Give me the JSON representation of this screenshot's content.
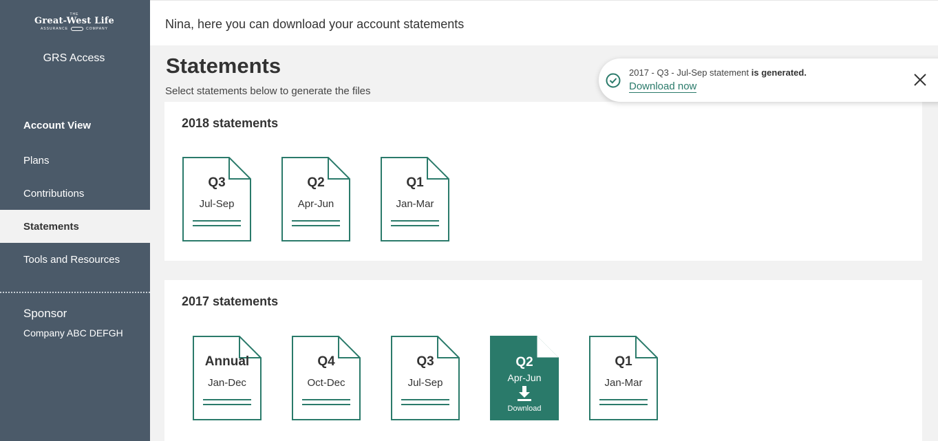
{
  "sidebar": {
    "logo": {
      "top": "THE",
      "name": "Great-West Life",
      "left_sub": "ASSURANCE",
      "right_sub": "COMPANY"
    },
    "app_name": "GRS Access",
    "items": [
      {
        "label": "Account View"
      },
      {
        "label": "Plans"
      },
      {
        "label": "Contributions"
      },
      {
        "label": "Statements"
      },
      {
        "label": "Tools and Resources"
      }
    ],
    "sponsor": {
      "title": "Sponsor",
      "company": "Company ABC DEFGH"
    }
  },
  "header": {
    "greeting": "Nina, here you can download your account statements"
  },
  "main": {
    "title": "Statements",
    "subtitle": "Select statements below to generate the files",
    "sections": [
      {
        "title": "2018 statements",
        "docs": [
          {
            "quarter": "Q3",
            "range": "Jul-Sep"
          },
          {
            "quarter": "Q2",
            "range": "Apr-Jun"
          },
          {
            "quarter": "Q1",
            "range": "Jan-Mar"
          }
        ]
      },
      {
        "title": "2017 statements",
        "docs": [
          {
            "quarter": "Annual",
            "range": "Jan-Dec"
          },
          {
            "quarter": "Q4",
            "range": "Oct-Dec"
          },
          {
            "quarter": "Q3",
            "range": "Jul-Sep"
          },
          {
            "quarter": "Q2",
            "range": "Apr-Jun",
            "action": "Download"
          },
          {
            "quarter": "Q1",
            "range": "Jan-Mar"
          }
        ]
      }
    ]
  },
  "toast": {
    "message": "2017 - Q3 - Jul-Sep statement ",
    "message_bold": "is generated.",
    "link": "Download now"
  },
  "colors": {
    "sidebar": "#4b5a69",
    "accent": "#2a7a6a",
    "background": "#f2f2f2"
  },
  "icons": {
    "success": "check-circle-icon",
    "close": "close-icon",
    "download": "download-arrow-icon"
  }
}
